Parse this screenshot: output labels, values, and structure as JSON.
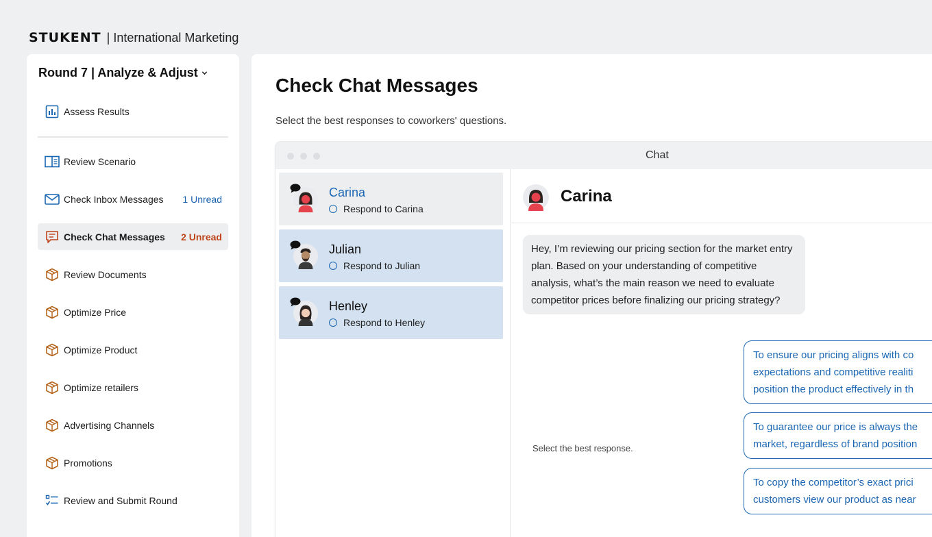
{
  "brand": {
    "logo": "STUKENT",
    "separator_title": "| International Marketing"
  },
  "sidebar": {
    "round_title": "Round 7 | Analyze & Adjust",
    "items": [
      {
        "label": "Assess Results",
        "icon": "bar-chart-icon",
        "badge": ""
      },
      {
        "label": "Review Scenario",
        "icon": "book-icon",
        "badge": ""
      },
      {
        "label": "Check Inbox Messages",
        "icon": "envelope-icon",
        "badge": "1 Unread"
      },
      {
        "label": "Check Chat Messages",
        "icon": "chat-icon",
        "badge": "2 Unread"
      },
      {
        "label": "Review Documents",
        "icon": "package-icon",
        "badge": ""
      },
      {
        "label": "Optimize Price",
        "icon": "package-icon",
        "badge": ""
      },
      {
        "label": "Optimize Product",
        "icon": "package-icon",
        "badge": ""
      },
      {
        "label": "Optimize retailers",
        "icon": "package-icon",
        "badge": ""
      },
      {
        "label": "Advertising Channels",
        "icon": "package-icon",
        "badge": ""
      },
      {
        "label": "Promotions",
        "icon": "package-icon",
        "badge": ""
      },
      {
        "label": "Review and Submit Round",
        "icon": "checklist-icon",
        "badge": ""
      }
    ]
  },
  "main": {
    "title": "Check Chat Messages",
    "subtitle": "Select the best responses to coworkers' questions."
  },
  "chat": {
    "window_title": "Chat",
    "contacts": [
      {
        "name": "Carina",
        "task": "Respond to Carina"
      },
      {
        "name": "Julian",
        "task": "Respond to Julian"
      },
      {
        "name": "Henley",
        "task": "Respond to Henley"
      }
    ],
    "active_contact": "Carina",
    "incoming_message": "Hey, I’m reviewing our pricing section for the market entry plan. Based on your understanding of competitive analysis, what’s the main reason we need to evaluate competitor prices before finalizing our pricing strategy?",
    "instruction": "Select the best response.",
    "options": [
      {
        "line1": "To ensure our pricing aligns with co",
        "line2": "expectations and competitive realiti",
        "line3": "position the product effectively in th"
      },
      {
        "line1": "To guarantee our price is always the",
        "line2": "market, regardless of brand position"
      },
      {
        "line1": "To copy the competitor’s exact prici",
        "line2": "customers view our product as near"
      }
    ]
  },
  "colors": {
    "accent_blue": "#1b66b3",
    "badge_red": "#c0441b",
    "icon_orange": "#b5651d",
    "contact_bg": "#d3e1f0"
  }
}
